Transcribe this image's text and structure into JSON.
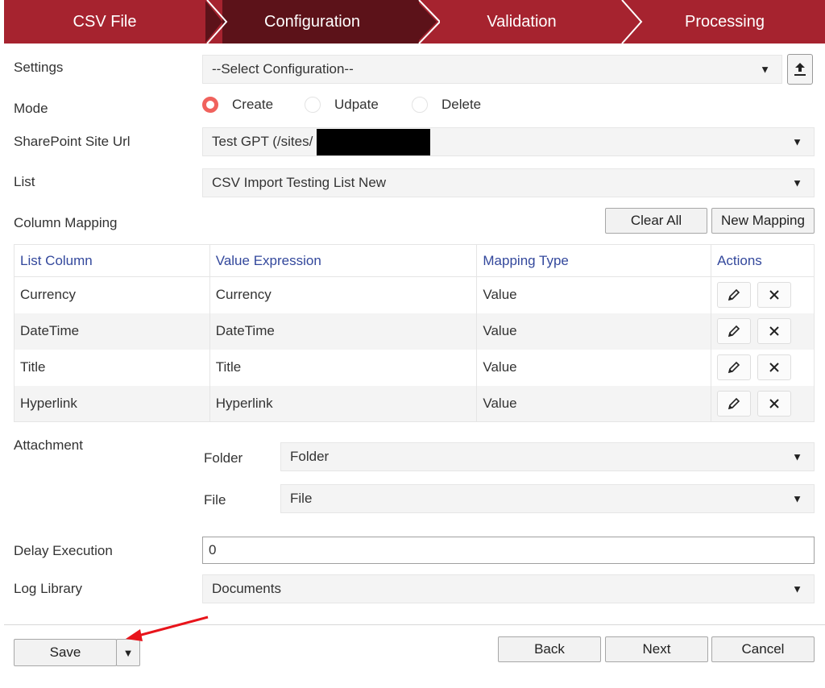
{
  "wizard": {
    "steps": [
      {
        "label": "CSV File"
      },
      {
        "label": "Configuration"
      },
      {
        "label": "Validation"
      },
      {
        "label": "Processing"
      }
    ]
  },
  "settings": {
    "label": "Settings",
    "value": "--Select Configuration--"
  },
  "mode": {
    "label": "Mode",
    "options": [
      "Create",
      "Udpate",
      "Delete"
    ],
    "selected": "Create"
  },
  "site": {
    "label": "SharePoint Site Url",
    "value": "Test GPT (/sites/"
  },
  "list": {
    "label": "List",
    "value": "CSV Import Testing List New"
  },
  "mapping": {
    "label": "Column Mapping",
    "clear_all": "Clear All",
    "new_mapping": "New Mapping",
    "headers": [
      "List Column",
      "Value Expression",
      "Mapping Type",
      "Actions"
    ],
    "rows": [
      [
        "Currency",
        "Currency",
        "Value"
      ],
      [
        "DateTime",
        "DateTime",
        "Value"
      ],
      [
        "Title",
        "Title",
        "Value"
      ],
      [
        "Hyperlink",
        "Hyperlink",
        "Value"
      ]
    ]
  },
  "attachment": {
    "label": "Attachment",
    "folder_label": "Folder",
    "folder_value": "Folder",
    "file_label": "File",
    "file_value": "File"
  },
  "delay": {
    "label": "Delay Execution",
    "value": "0"
  },
  "log": {
    "label": "Log Library",
    "value": "Documents"
  },
  "footer": {
    "save": "Save",
    "back": "Back",
    "next": "Next",
    "cancel": "Cancel"
  },
  "colors": {
    "wizard": "#a6232f",
    "wizard_active": "#5c1219",
    "header_text": "#33489c",
    "radio_selected": "#f0625d",
    "arrow": "#e8141b"
  },
  "icons": {
    "upload": "upload-icon",
    "dropdown": "dropdown-arrow-icon",
    "edit": "pencil-icon",
    "delete": "close-icon"
  }
}
